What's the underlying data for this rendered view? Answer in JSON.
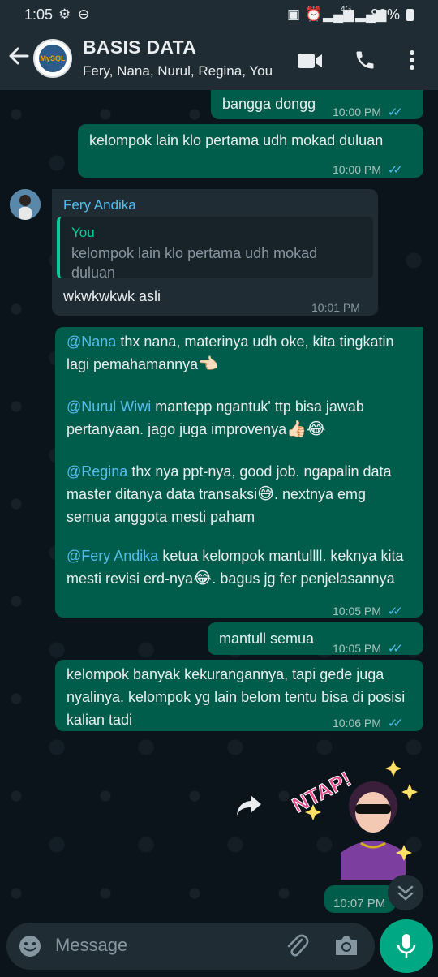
{
  "status_bar": {
    "time": "1:05",
    "signal_4g": "4G",
    "battery": "80%"
  },
  "header": {
    "title": "BASIS DATA",
    "participants": "Fery, Nana, Nurul, Regina, You",
    "avatar_text": "MySQL"
  },
  "messages": {
    "m1": {
      "text": "bangga dongg",
      "time": "10:00 PM"
    },
    "m2": {
      "text": "kelompok lain klo pertama udh mokad duluan",
      "time": "10:00 PM"
    },
    "m3": {
      "sender": "Fery Andika",
      "quote_name": "You",
      "quote_text": "kelompok lain klo pertama udh mokad duluan",
      "text": "wkwkwkwk asli",
      "time": "10:01 PM"
    },
    "m4": {
      "p1_mention": "@Nana",
      "p1_text": " thx nana, materinya udh oke, kita tingkatin lagi pemahamannya",
      "p1_emoji": "👈🏻",
      "p2_mention": "@Nurul Wiwi",
      "p2_text": " mantepp ngantuk' ttp bisa jawab pertanyaan. jago juga improvenya",
      "p2_emoji": "👍🏻😂",
      "p3_mention": "@Regina",
      "p3_text_a": " thx nya ppt-nya, good job. ngapalin data master ditanya data transaksi",
      "p3_emoji": "😅",
      "p3_text_b": ". nextnya emg semua anggota mesti paham",
      "p4_mention": "@Fery Andika",
      "p4_text_a": " ketua kelompok mantullll. keknya kita mesti revisi erd-nya",
      "p4_emoji": "😂",
      "p4_text_b": ". bagus jg fer penjelasannya",
      "time": "10:05 PM"
    },
    "m5": {
      "text": "mantull semua",
      "time": "10:05 PM"
    },
    "m6": {
      "text": "kelompok banyak kekurangannya, tapi gede juga nyalinya. kelompok yg lain belom tentu bisa di posisi kalian tadi",
      "time": "10:06 PM"
    },
    "m7": {
      "sticker_text": "NTAP!",
      "time": "10:07 PM"
    }
  },
  "input": {
    "placeholder": "Message"
  },
  "colors": {
    "header_bg": "#1f2c34",
    "chat_bg": "#0b141a",
    "outgoing_bubble": "#005c4b",
    "incoming_bubble": "#1f2c34",
    "accent_green": "#00a884",
    "read_tick": "#53bdeb"
  }
}
